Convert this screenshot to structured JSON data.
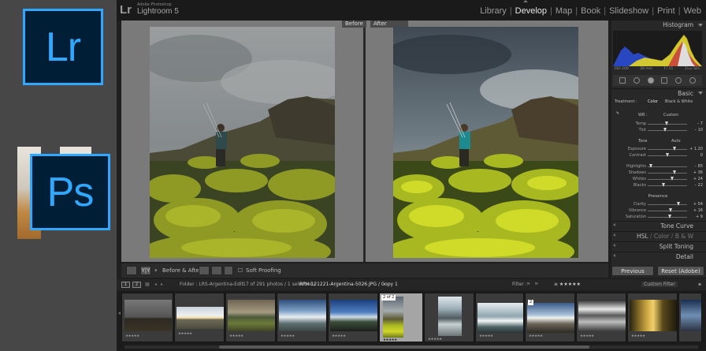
{
  "promo": {
    "lr_logo_text": "Lr",
    "ps_logo_text": "Ps",
    "brand_color": "#31a8ff",
    "logo_bg": "#001e36"
  },
  "app": {
    "mark": "Lr",
    "vendor": "Adobe Photoshop",
    "title": "Lightroom 5",
    "modules": [
      "Library",
      "Develop",
      "Map",
      "Book",
      "Slideshow",
      "Print",
      "Web"
    ],
    "active_module": "Develop"
  },
  "compare": {
    "before_label": "Before",
    "after_label": "After"
  },
  "toolbar": {
    "view_mode_label": "Y|Y",
    "before_after_label": "Before & After :",
    "soft_proofing_label": "Soft Proofing"
  },
  "right_panel": {
    "histogram_label": "Histogram",
    "histogram_info": [
      "ISO 200",
      "28 mm",
      "f / 11",
      "1/₁₂₅ SEC"
    ],
    "basic_label": "Basic",
    "treatment_label": "Treatment :",
    "treatment_color": "Color",
    "treatment_bw": "Black & White",
    "wb_label": "WB :",
    "wb_value": "Custom",
    "tone_label": "Tone",
    "tone_auto": "Auto",
    "presence_label": "Presence",
    "sliders": [
      {
        "label": "Temp",
        "value": "– 7",
        "pos": 0.48
      },
      {
        "label": "Tint",
        "value": "– 10",
        "pos": 0.44
      },
      {
        "label": "Exposure",
        "value": "+ 1.20",
        "pos": 0.68
      },
      {
        "label": "Contrast",
        "value": "0",
        "pos": 0.5
      },
      {
        "label": "Highlights",
        "value": "– 85",
        "pos": 0.08
      },
      {
        "label": "Shadows",
        "value": "+ 36",
        "pos": 0.68
      },
      {
        "label": "Whites",
        "value": "+ 24",
        "pos": 0.62
      },
      {
        "label": "Blacks",
        "value": "– 22",
        "pos": 0.39
      },
      {
        "label": "Clarity",
        "value": "+ 54",
        "pos": 0.77
      },
      {
        "label": "Vibrance",
        "value": "+ 16",
        "pos": 0.58
      },
      {
        "label": "Saturation",
        "value": "+ 9",
        "pos": 0.55
      }
    ],
    "tone_curve_label": "Tone Curve",
    "hsl_label": "HSL",
    "color_label": "Color",
    "bw_label": "B & W",
    "split_toning_label": "Split Toning",
    "detail_label": "Detail",
    "previous_button": "Previous",
    "reset_button": "Reset (Adobe)"
  },
  "filmstrip_bar": {
    "folder_label": "Folder : LRS-Argentina-Edit",
    "count_label": "17 of 291 photos / 1 selected /",
    "filename": "RPH-121221-Argentina-5026.JPG / Copy 1",
    "filter_label": "Filter :",
    "rating_filter": "≥ ★★★★★",
    "custom_filter": "Custom Filter",
    "page_1": "1",
    "page_2": "2"
  },
  "filmstrip": {
    "stars": "★★★★★",
    "selected_badge": "2 of 2",
    "badge_2": "2"
  }
}
